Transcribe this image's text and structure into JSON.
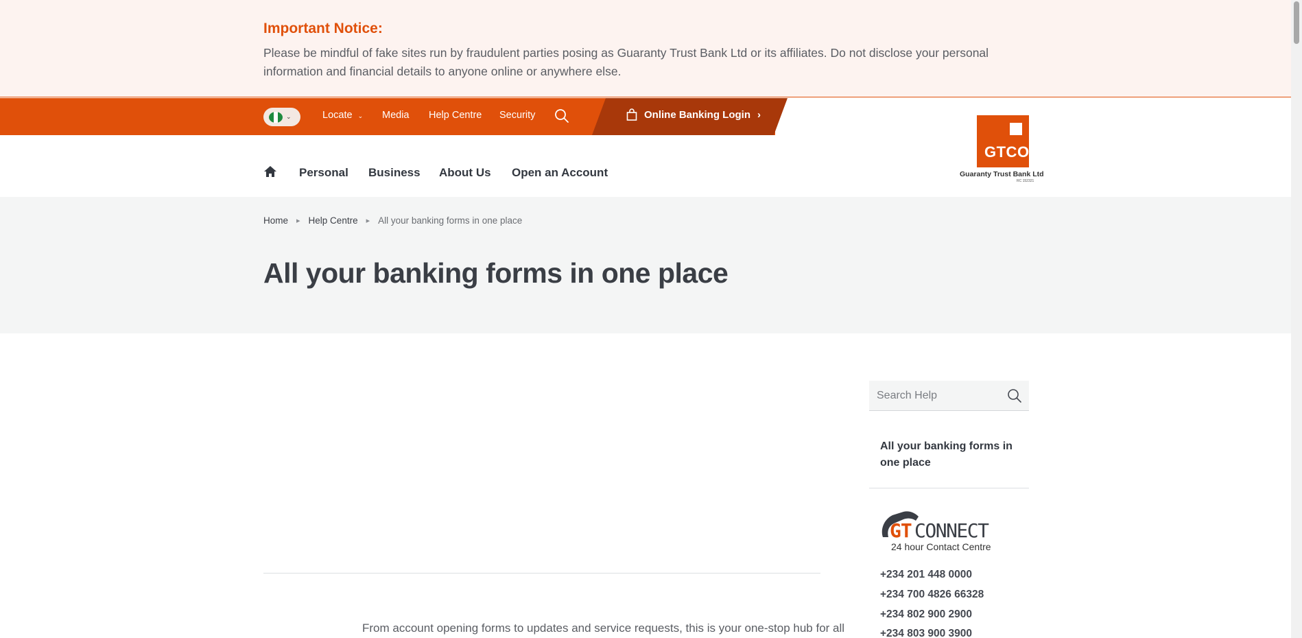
{
  "notice": {
    "title": "Important Notice:",
    "body": "Please be mindful of fake sites run by fraudulent parties posing as Guaranty Trust Bank Ltd or its affiliates. Do not disclose your personal information and financial details to anyone online or anywhere else."
  },
  "topbar": {
    "country_flag": "nigeria-flag-icon",
    "links": [
      "Locate",
      "Media",
      "Help Centre",
      "Security"
    ],
    "search_icon": "search-icon",
    "login_label": "Online Banking Login",
    "colors": {
      "bar": "#e0500a",
      "login_band": "#a8380a"
    }
  },
  "logo": {
    "text": "GTCO",
    "caption": "Guaranty Trust Bank Ltd",
    "rc": "RC 152321"
  },
  "main_nav": {
    "home_icon": "home-icon",
    "items": [
      "Personal",
      "Business",
      "About Us",
      "Open an Account"
    ]
  },
  "breadcrumb": {
    "home": "Home",
    "parent": "Help Centre",
    "current": "All your banking forms in one place"
  },
  "page_title": "All your banking forms in one place",
  "intro_text": "From account opening forms to updates and service requests, this is your one-stop hub for all",
  "sidebar": {
    "search_placeholder": "Search Help",
    "active_link": "All your banking forms in one place",
    "gtconnect": {
      "gt": "GT",
      "connect": "CONNECT",
      "subtitle": "24 hour Contact Centre"
    },
    "phones": [
      "+234 201 448 0000",
      "+234 700 4826 66328",
      "+234 802 900 2900",
      "+234 803 900 3900"
    ]
  }
}
